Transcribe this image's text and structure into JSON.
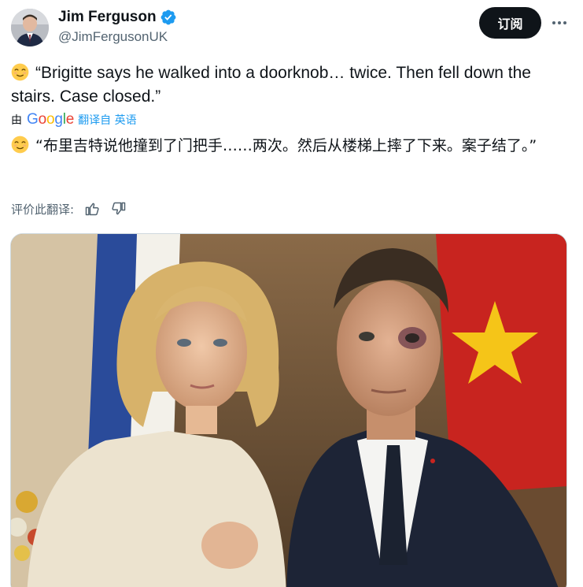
{
  "user": {
    "display_name": "Jim Ferguson",
    "handle": "@JimFergusonUK",
    "verified": true,
    "avatar_icon": "avatar-photo"
  },
  "header": {
    "subscribe_label": "订阅",
    "more_icon": "more-horizontal-icon"
  },
  "tweet": {
    "emoji_icon": "relieved-face-emoji",
    "text": "“Brigitte says he walked into a doorknob… twice. Then fell down the stairs. Case closed.”"
  },
  "translation": {
    "by_label": "由",
    "provider": "Google",
    "link_label": "翻译自 英语",
    "text": "“布里吉特说他撞到了门把手……两次。然后从楼梯上摔了下来。案子结了。”"
  },
  "rating": {
    "label": "评价此翻译:",
    "thumbs_up_icon": "thumbs-up-icon",
    "thumbs_down_icon": "thumbs-down-icon"
  },
  "colors": {
    "accent": "#1d9bf0",
    "text_primary": "#0f1419",
    "text_secondary": "#536471",
    "button_dark": "#0f1419",
    "google_blue": "#4285f4",
    "google_red": "#ea4335",
    "google_yellow": "#fbbc05",
    "google_green": "#34a853"
  }
}
